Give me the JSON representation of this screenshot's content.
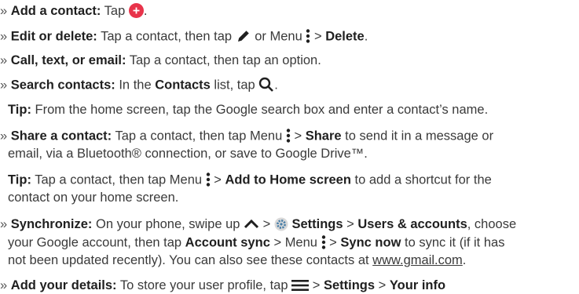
{
  "items": {
    "add": {
      "label": "Add a contact:",
      "t1": "Tap",
      "t2": "."
    },
    "edit": {
      "label": "Edit or delete:",
      "t1": "Tap a contact, then tap",
      "t2": "or Menu",
      "t3": ">",
      "b1": "Delete",
      "t4": "."
    },
    "call": {
      "label": "Call, text, or email:",
      "t1": "Tap a contact, then tap an option."
    },
    "search": {
      "label": "Search contacts:",
      "t1": "In the",
      "b1": "Contacts",
      "t2": "list, tap",
      "t3": "."
    },
    "tip1": {
      "label": "Tip:",
      "t1": "From the home screen, tap the Google search box and enter a contact’s name."
    },
    "share": {
      "label": "Share a contact:",
      "t1": "Tap a contact, then tap Menu",
      "t2": ">",
      "b1": "Share",
      "t3": "to send it in a message or",
      "l2": "email, via a Bluetooth® connection, or save to Google Drive™."
    },
    "tip2": {
      "label": "Tip:",
      "t1": "Tap a contact, then tap Menu",
      "t2": ">",
      "b1": "Add to Home screen",
      "t3": "to add a shortcut for the",
      "l2": "contact on your home screen."
    },
    "sync": {
      "label": "Synchronize:",
      "t1": "On your phone, swipe up",
      "t2": ">",
      "b1": "Settings",
      "t3": ">",
      "b2": "Users & accounts",
      "t4": ", choose",
      "l2a": "your Google account, then tap",
      "l2b": "Account sync",
      "l2c": "> Menu",
      "l2d": ">",
      "l2e": "Sync now",
      "l2f": "to sync it (if it has",
      "l3a": "not been updated recently). You can also see these contacts at",
      "l3link": "www.gmail.com",
      "l3b": "."
    },
    "details": {
      "label": "Add your details:",
      "t1": "To store your user profile, tap",
      "t2": ">",
      "b1": "Settings",
      "t3": ">",
      "b2": "Your info"
    }
  },
  "bullet": "»",
  "colors": {
    "add_icon": "#e8334a",
    "text": "#3a3a3a",
    "bold": "#1f1f1f"
  }
}
